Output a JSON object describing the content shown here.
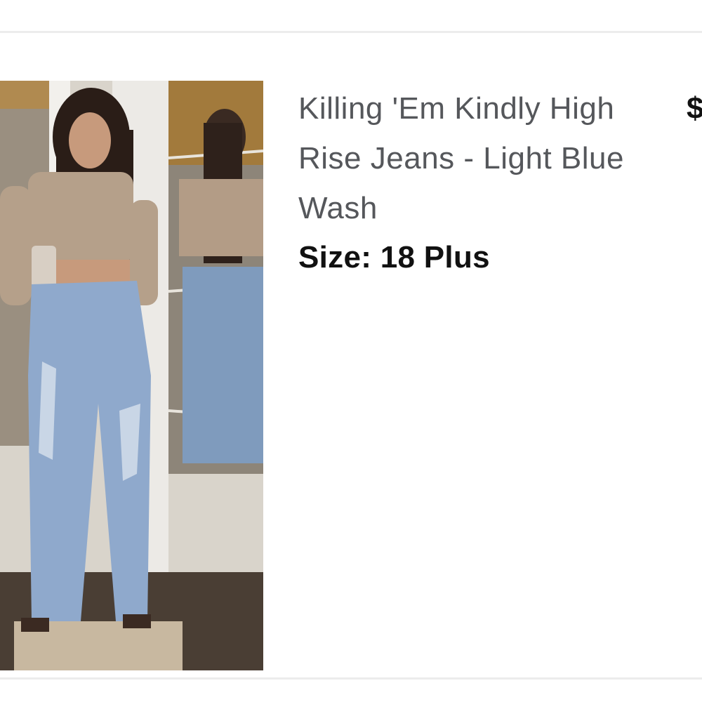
{
  "item": {
    "image_alt": "Model wearing light blue wash high rise ripped jeans with beige crop top",
    "title": "Killing 'Em Kindly High Rise Jeans - Light Blue Wash",
    "size_label": "Size: 18 Plus",
    "price_visible": "$"
  }
}
